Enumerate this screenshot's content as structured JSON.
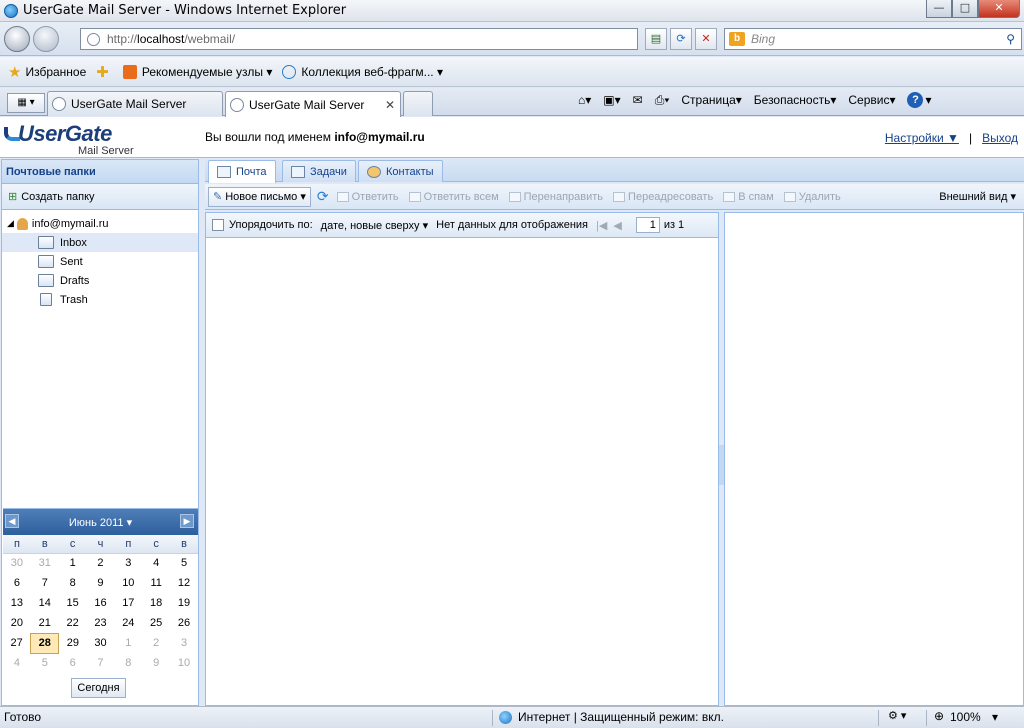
{
  "window": {
    "title": "UserGate Mail Server - Windows Internet Explorer",
    "min": "—",
    "max": "□",
    "close": "✕"
  },
  "address": {
    "url_prefix": "http://",
    "url_host": "localhost",
    "url_path": "/webmail/",
    "search_placeholder": "Bing"
  },
  "favorites_bar": {
    "favorites": "Избранное",
    "recommended": "Рекомендуемые узлы",
    "gallery": "Коллекция веб-фрагм..."
  },
  "browser_tabs": [
    {
      "label": "UserGate Mail Server"
    },
    {
      "label": "UserGate Mail Server"
    }
  ],
  "command_bar": {
    "page": "Страница",
    "safety": "Безопасность",
    "tools": "Сервис",
    "help": "?"
  },
  "header": {
    "logo_main": "UserGate",
    "logo_sub": "Mail Server",
    "login_prefix": "Вы вошли под именем",
    "login_user": "info@mymail.ru",
    "settings": "Настройки ▼",
    "separator": "|",
    "logout": "Выход"
  },
  "sidebar": {
    "title": "Почтовые папки",
    "create_folder": "Создать папку",
    "account": "info@mymail.ru",
    "folders": [
      {
        "label": "Inbox"
      },
      {
        "label": "Sent"
      },
      {
        "label": "Drafts"
      },
      {
        "label": "Trash"
      }
    ]
  },
  "calendar": {
    "month": "Июнь 2011",
    "weekdays": [
      "п",
      "в",
      "с",
      "ч",
      "п",
      "с",
      "в"
    ],
    "weeks": [
      [
        "30",
        "31",
        "1",
        "2",
        "3",
        "4",
        "5"
      ],
      [
        "6",
        "7",
        "8",
        "9",
        "10",
        "11",
        "12"
      ],
      [
        "13",
        "14",
        "15",
        "16",
        "17",
        "18",
        "19"
      ],
      [
        "20",
        "21",
        "22",
        "23",
        "24",
        "25",
        "26"
      ],
      [
        "27",
        "28",
        "29",
        "30",
        "1",
        "2",
        "3"
      ],
      [
        "4",
        "5",
        "6",
        "7",
        "8",
        "9",
        "10"
      ]
    ],
    "today_label": "Сегодня"
  },
  "main_tabs": [
    {
      "label": "Почта"
    },
    {
      "label": "Задачи"
    },
    {
      "label": "Контакты"
    }
  ],
  "toolbar": {
    "new_mail": "Новое письмо",
    "reply": "Ответить",
    "reply_all": "Ответить всем",
    "forward": "Перенаправить",
    "redirect": "Переадресовать",
    "spam": "В спам",
    "delete": "Удалить",
    "view": "Внешний вид"
  },
  "list": {
    "sort_label": "Упорядочить по:",
    "sort_value": "дате, новые сверху",
    "empty": "Нет данных для отображения",
    "page": "1",
    "of": "из 1"
  },
  "statusbar": {
    "ready": "Готово",
    "zone": "Интернет | Защищенный режим: вкл.",
    "zoom": "100%"
  }
}
